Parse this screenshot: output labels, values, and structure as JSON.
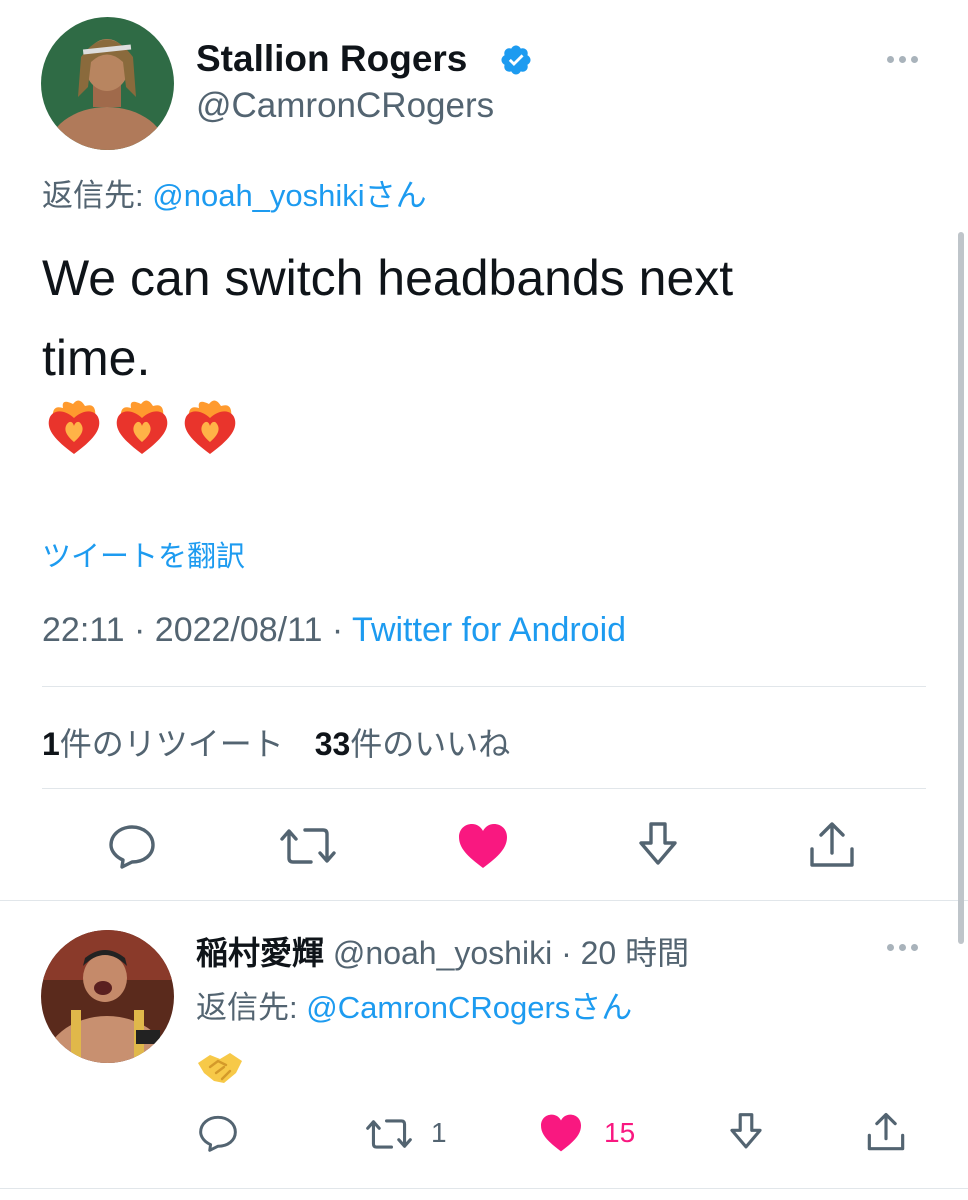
{
  "main_tweet": {
    "author_name": "Stallion Rogers",
    "author_handle": "@CamronCRogers",
    "reply_prefix": "返信先:",
    "reply_to": "@noah_yoshiki",
    "reply_suffix": "さん",
    "text_line1": "We can switch headbands next",
    "text_line2": "time.",
    "emoji": "❤️‍🔥 ❤️‍🔥 ❤️‍🔥",
    "translate_label": "ツイートを翻訳",
    "time": "22:11",
    "date": "2022/08/11",
    "source": "Twitter for Android",
    "retweet_count": "1",
    "retweet_label": "件のリツイート",
    "like_count": "33",
    "like_label": "件のいいね",
    "liked": true
  },
  "reply_tweet": {
    "author_name": "稲村愛輝",
    "author_handle": "@noah_yoshiki",
    "time_ago": "20 時間",
    "reply_prefix": "返信先:",
    "reply_to": "@CamronCRogers",
    "reply_suffix": "さん",
    "emoji": "🤝",
    "retweet_count": "1",
    "like_count": "15",
    "liked": true
  },
  "colors": {
    "accent": "#1d9bf0",
    "like": "#f91880",
    "text": "#0f1419",
    "muted": "#536471"
  },
  "icons": [
    "verified-badge-icon",
    "more-icon",
    "reply-icon",
    "retweet-icon",
    "heart-icon",
    "bookmark-icon",
    "share-icon"
  ]
}
